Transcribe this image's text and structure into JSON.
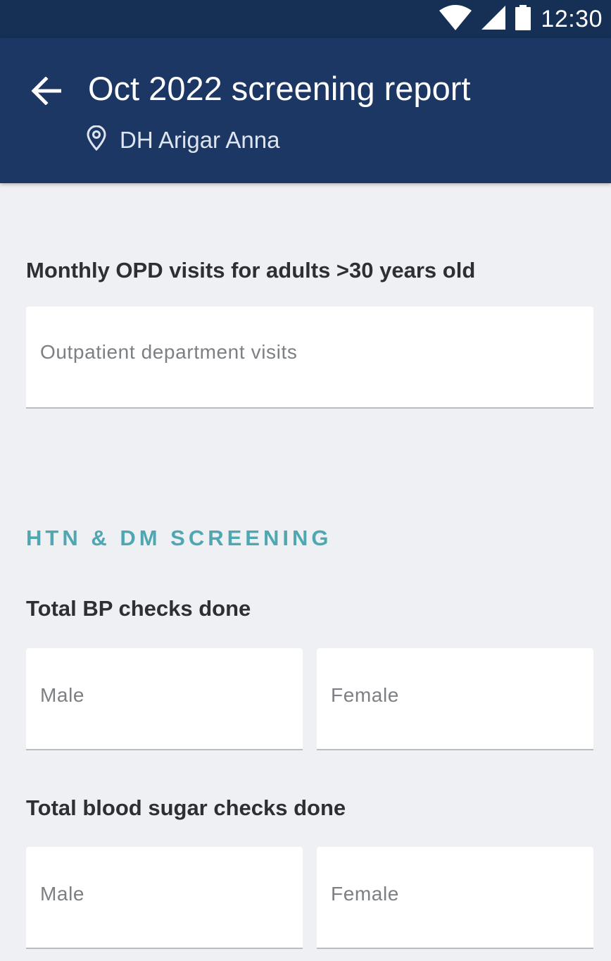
{
  "status_bar": {
    "time": "12:30",
    "icons": [
      "wifi-icon",
      "signal-icon",
      "battery-icon"
    ]
  },
  "app_bar": {
    "title": "Oct 2022 screening report",
    "facility": "DH Arigar Anna",
    "back_icon": "arrow-left-icon",
    "location_icon": "location-pin-icon"
  },
  "opd": {
    "label": "Monthly OPD visits for adults >30 years old",
    "placeholder": "Outpatient department visits",
    "value": ""
  },
  "section": {
    "title": "HTN & DM SCREENING"
  },
  "bp_checks": {
    "label": "Total BP checks done",
    "male_placeholder": "Male",
    "female_placeholder": "Female"
  },
  "sugar_checks": {
    "label": "Total blood sugar checks done",
    "male_placeholder": "Male",
    "female_placeholder": "Female"
  },
  "colors": {
    "status_bar": "#152f55",
    "app_bar": "#1c3763",
    "background": "#eff0f4",
    "section_accent": "#4fa7b2",
    "label_text": "#2c2f33",
    "placeholder_text": "#7c7f84"
  }
}
